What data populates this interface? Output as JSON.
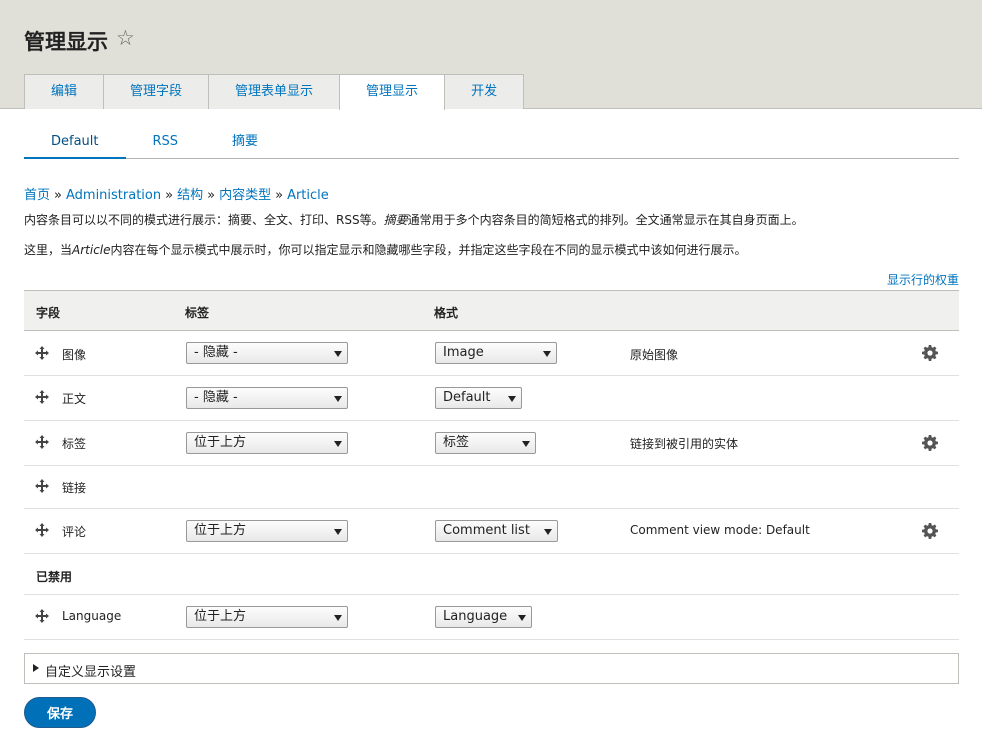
{
  "page": {
    "title": "管理显示"
  },
  "tabs": [
    {
      "label": "编辑"
    },
    {
      "label": "管理字段"
    },
    {
      "label": "管理表单显示"
    },
    {
      "label": "管理显示",
      "active": true
    },
    {
      "label": "开发"
    }
  ],
  "subtabs": [
    {
      "label": "Default",
      "active": true
    },
    {
      "label": "RSS"
    },
    {
      "label": "摘要"
    }
  ],
  "breadcrumb": [
    "首页",
    "Administration",
    "结构",
    "内容类型",
    "Article"
  ],
  "description": {
    "line1_a": "内容条目可以以不同的模式进行展示：摘要、全文、打印、RSS等。",
    "line1_em": "摘要",
    "line1_b": "通常用于多个内容条目的简短格式的排列。全文通常显示在其自身页面上。",
    "line2_a": "这里，当",
    "line2_em": "Article",
    "line2_b": "内容在每个显示模式中展示时，你可以指定显示和隐藏哪些字段，并指定这些字段在不同的显示模式中该如何进行展示。"
  },
  "weights_link": "显示行的权重",
  "table": {
    "headers": {
      "field": "字段",
      "label": "标签",
      "format": "格式"
    },
    "rows": [
      {
        "name": "图像",
        "label": "- 隐藏 -",
        "format": "Image",
        "summary": "原始图像",
        "gear": true
      },
      {
        "name": "正文",
        "label": "- 隐藏 -",
        "format": "Default",
        "summary": "",
        "gear": false
      },
      {
        "name": "标签",
        "label": "位于上方",
        "format": "标签",
        "summary": "链接到被引用的实体",
        "gear": true
      },
      {
        "name": "链接"
      },
      {
        "name": "评论",
        "label": "位于上方",
        "format": "Comment list",
        "summary": "Comment view mode: Default",
        "gear": true
      }
    ],
    "disabled_region": "已禁用",
    "disabled_rows": [
      {
        "name": "Language",
        "label": "位于上方",
        "format": "Language",
        "summary": "",
        "gear": false
      }
    ]
  },
  "details": {
    "label": "自定义显示设置"
  },
  "save_label": "保存",
  "colors": {
    "link": "#0074bd",
    "primary_button": "#0071b8",
    "header_bg": "#e0e0d8"
  },
  "icons": {
    "star": "star-icon",
    "drag": "drag-handle-icon",
    "gear": "gear-icon"
  }
}
